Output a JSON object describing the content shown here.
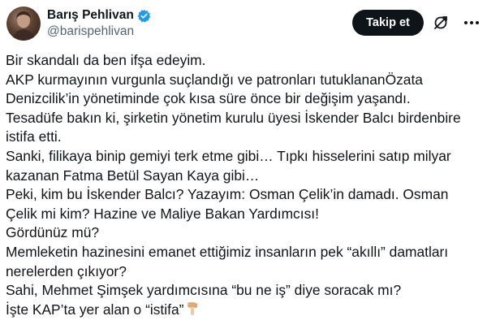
{
  "author": {
    "display_name": "Barış Pehlivan",
    "handle": "@barispehlivan",
    "verified": true,
    "verified_color": "#1d9bf0"
  },
  "actions": {
    "follow_label": "Takip et",
    "grok_icon": "grok-icon",
    "more_icon": "more-options-icon"
  },
  "tweet": {
    "lines": [
      "Bir skandalı da ben ifşa edeyim.",
      "AKP kurmayının vurgunla suçlandığı ve patronları tutuklananÖzata",
      "Denizcilik’in yönetiminde çok kısa süre önce bir değişim yaşandı.",
      "Tesadüfe bakın ki, şirketin yönetim kurulu üyesi İskender Balcı birdenbire",
      "istifa etti.",
      "Sanki, filikaya binip gemiyi terk etme gibi… Tıpkı hisselerini satıp milyar",
      "kazanan Fatma Betül Sayan Kaya gibi…",
      "Peki, kim bu İskender Balcı? Yazayım: Osman Çelik’in damadı. Osman",
      "Çelik mi kim? Hazine ve Maliye Bakan Yardımcısı!",
      "Gördünüz mü?",
      "Memleketin hazinesini emanet ettiğimiz insanların pek “akıllı” damatları",
      "nerelerden çıkıyor?",
      "Sahi, Mehmet Şimşek yardımcısına “bu ne iş” diye soracak mı?",
      "İşte KAP’ta yer alan o “istifa”"
    ],
    "trailing_emoji": "backhand-index-pointing-down"
  }
}
